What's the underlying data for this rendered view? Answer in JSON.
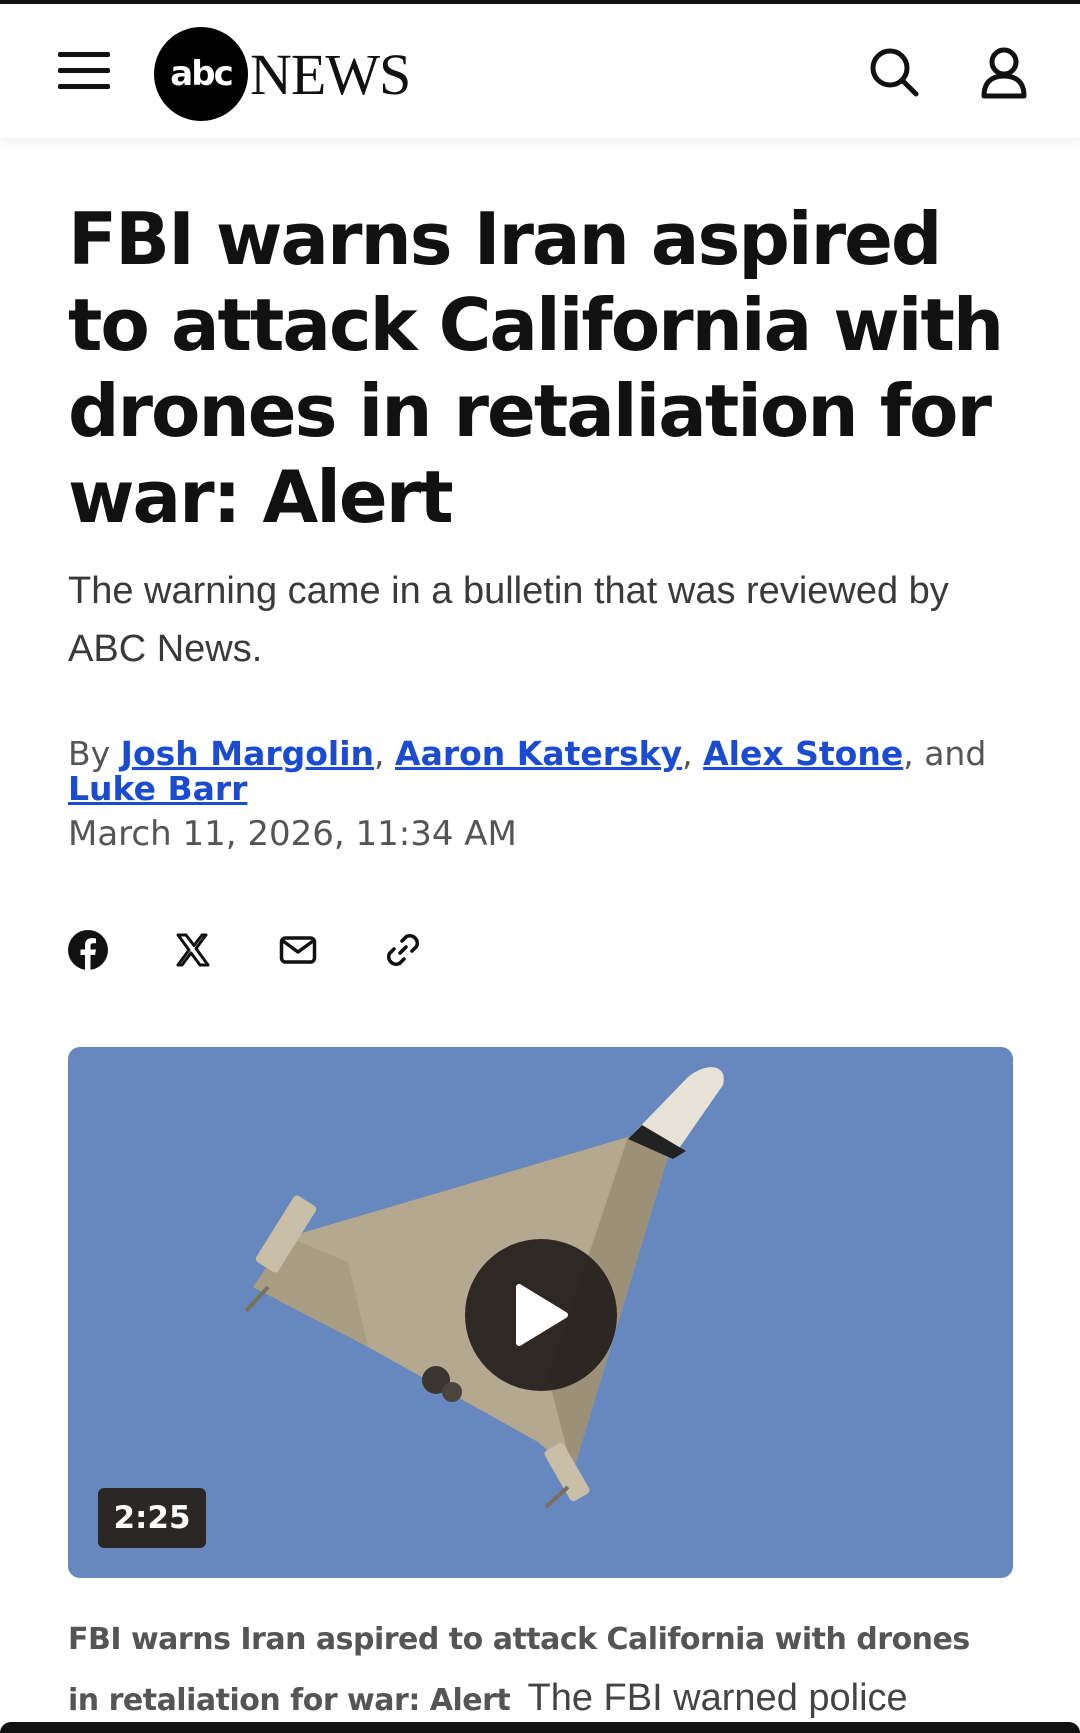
{
  "header": {
    "logo_abc": "abc",
    "logo_news": "NEWS",
    "icons": {
      "menu": "hamburger-menu-icon",
      "search": "search-icon",
      "account": "user-icon"
    }
  },
  "article": {
    "headline": "FBI warns Iran aspired to attack California with drones in retaliation for war: Alert",
    "subheadline": "The warning came in a bulletin that was reviewed by ABC News.",
    "byline": {
      "prefix": "By ",
      "authors": [
        "Josh Margolin",
        "Aaron Katersky",
        "Alex Stone",
        "Luke Barr"
      ],
      "sep1": ", ",
      "sep2": ", ",
      "sep3": ", and "
    },
    "date": "March 11, 2026, 11:34 AM",
    "share_icons": [
      "facebook-icon",
      "x-icon",
      "email-icon",
      "link-icon"
    ]
  },
  "video": {
    "duration": "2:25",
    "background_color": "#6788be",
    "caption_title": "FBI warns Iran aspired to attack California with drones in retaliation for war: Alert",
    "caption_text": "The FBI warned police"
  },
  "colors": {
    "link": "#1a4bd1",
    "text": "#111111",
    "muted": "#555555"
  }
}
